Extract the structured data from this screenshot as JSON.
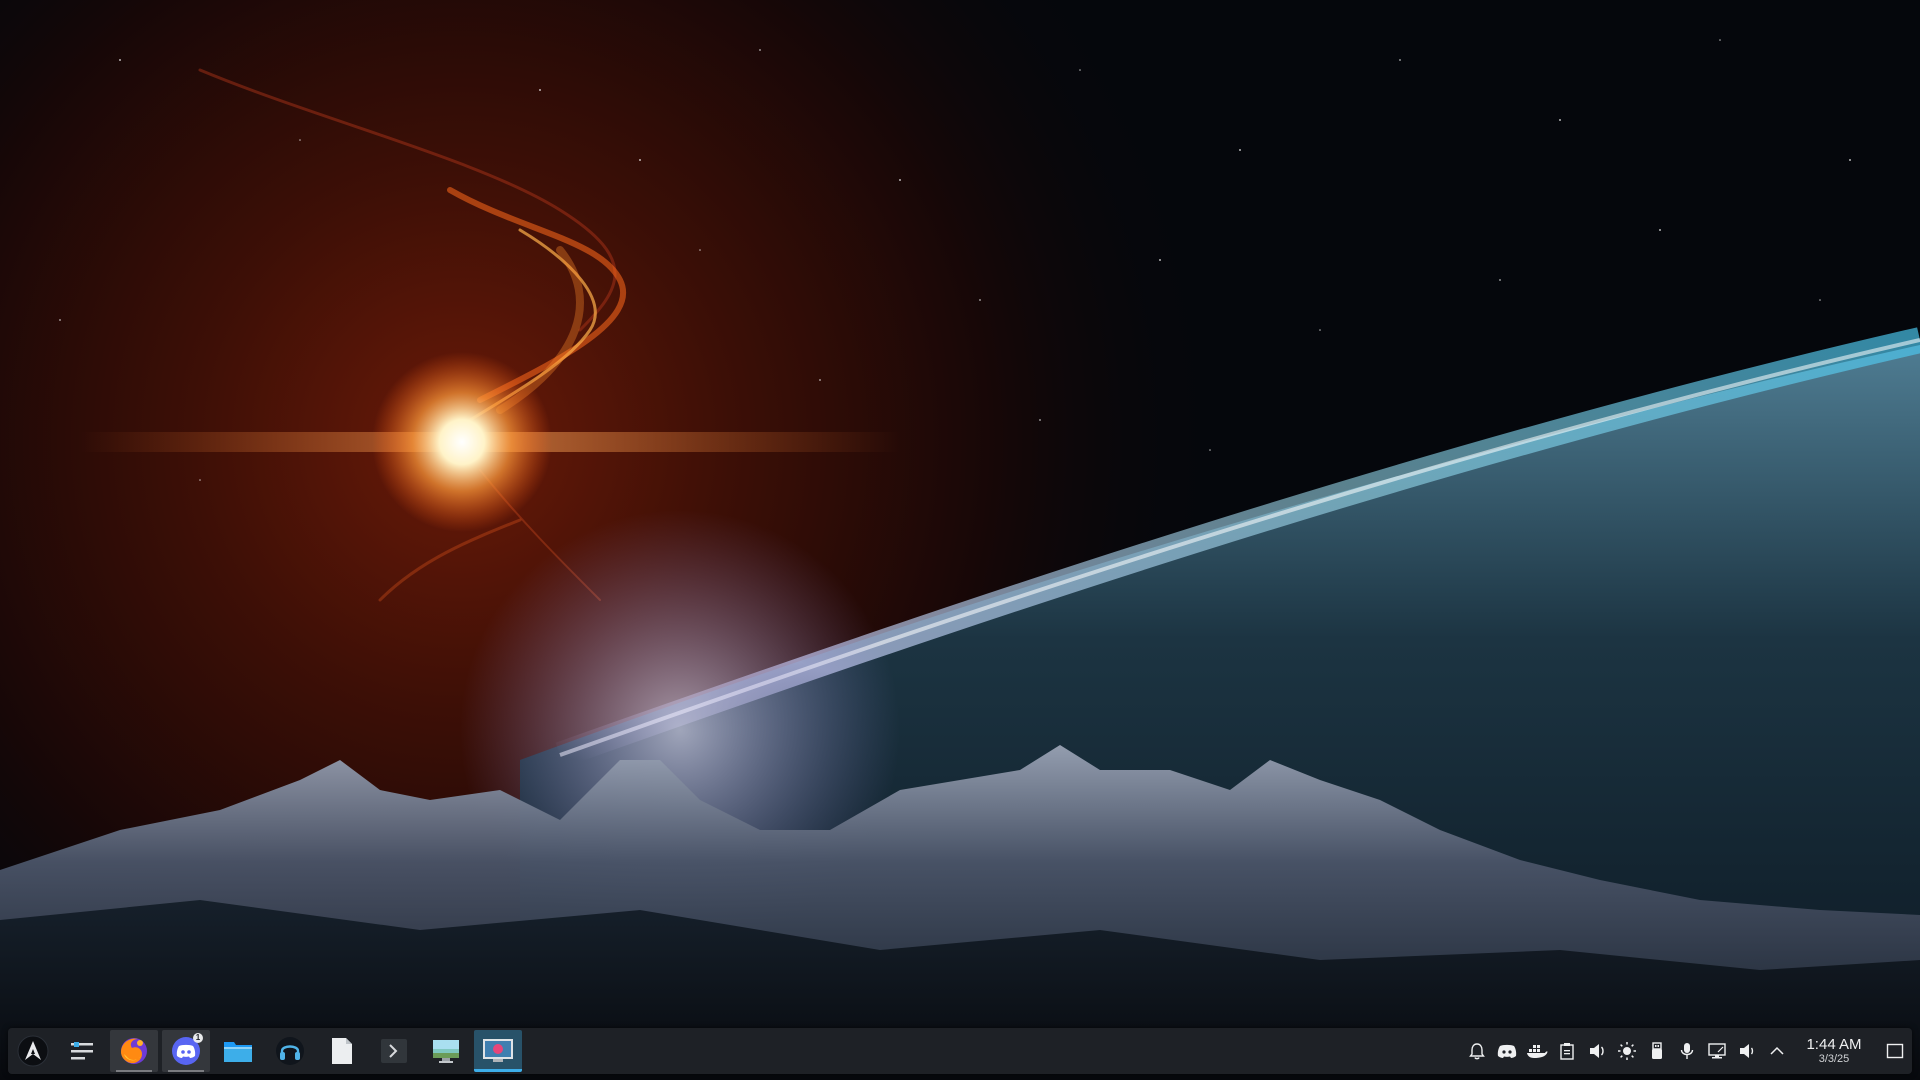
{
  "desktop": {
    "wallpaper": "space nebula over snowy mountain range and planet horizon"
  },
  "taskbar": {
    "launcher_icon": "arch-linux-icon",
    "tasks": [
      {
        "id": "kickoff-menu",
        "icon": "menu-lines-icon",
        "open": false
      },
      {
        "id": "firefox",
        "icon": "firefox-icon",
        "open": true
      },
      {
        "id": "discord",
        "icon": "discord-icon",
        "open": true,
        "badge": "1"
      },
      {
        "id": "file-manager",
        "icon": "folder-icon",
        "open": false
      },
      {
        "id": "headset",
        "icon": "headphones-icon",
        "open": false
      },
      {
        "id": "text-editor",
        "icon": "document-icon",
        "open": false
      },
      {
        "id": "terminal",
        "icon": "terminal-icon",
        "open": false
      },
      {
        "id": "system-monitor",
        "icon": "monitor-icon",
        "open": false
      },
      {
        "id": "screenshot",
        "icon": "screenshot-icon",
        "open": true,
        "active": true
      }
    ],
    "tray": [
      "notifications-icon",
      "discord-tray-icon",
      "docker-icon",
      "clipboard-icon",
      "audio-icon",
      "brightness-icon",
      "usb-icon",
      "microphone-icon",
      "network-icon",
      "volume-icon",
      "expand-tray-icon"
    ],
    "clock": {
      "time": "1:44 AM",
      "date": "3/3/25"
    },
    "colors": {
      "accent": "#3daee9",
      "panel": "#1f2228",
      "text": "#eff0f1"
    }
  }
}
